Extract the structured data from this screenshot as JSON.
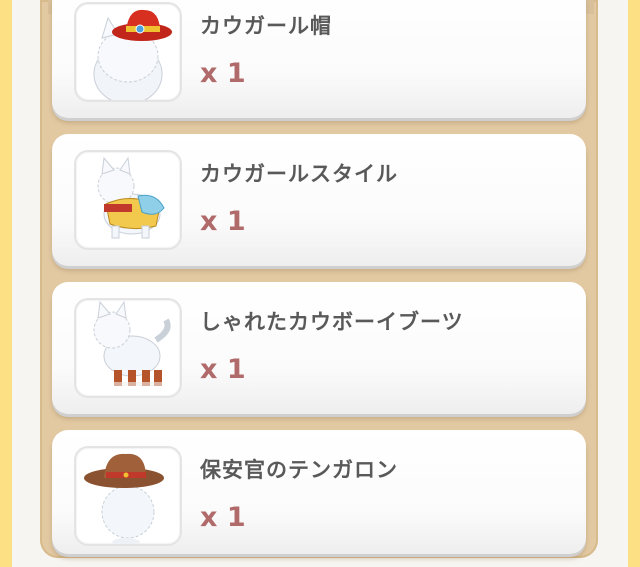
{
  "items": [
    {
      "name": "カウガール帽",
      "quantity": "x 1",
      "icon": "cowgirl-hat-cat-icon"
    },
    {
      "name": "カウガールスタイル",
      "quantity": "x 1",
      "icon": "cowgirl-style-cat-icon"
    },
    {
      "name": "しゃれたカウボーイブーツ",
      "quantity": "x 1",
      "icon": "cowboy-boots-cat-icon"
    },
    {
      "name": "保安官のテンガロン",
      "quantity": "x 1",
      "icon": "sheriff-ten-gallon-cat-icon"
    }
  ],
  "colors": {
    "background_yellow": "#fde083",
    "frame_tan": "#e2c9a2",
    "card_white": "#ffffff",
    "name_text": "#595959",
    "quantity_text": "#b06a6a"
  }
}
